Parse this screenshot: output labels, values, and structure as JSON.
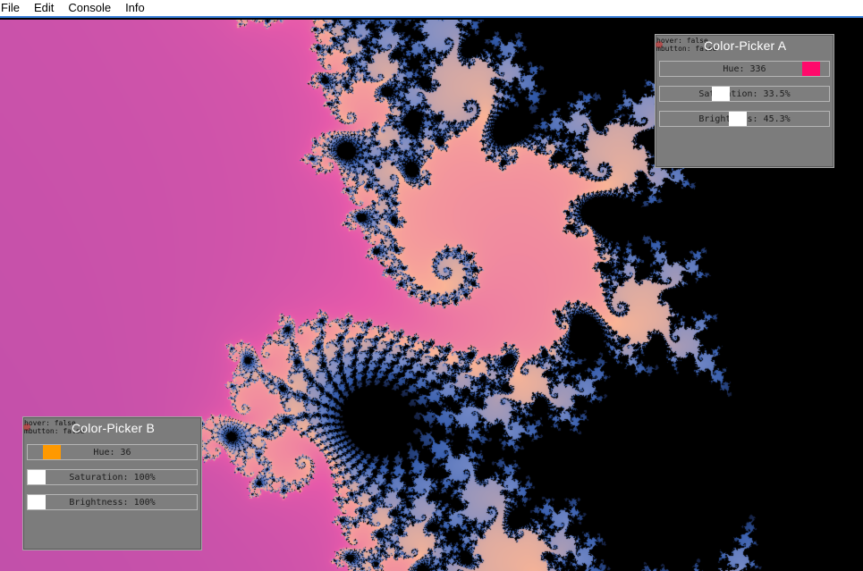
{
  "menu": {
    "items": [
      "File",
      "Edit",
      "Console",
      "Info"
    ]
  },
  "picker_a": {
    "title": "Color-Picker A",
    "debug_hover": "hover: false",
    "debug_mbutton": "mbutton: false",
    "hue": {
      "label": "Hue: 336",
      "value": 336,
      "swatch_color": "#ff0a6b"
    },
    "saturation": {
      "label": "Saturation: 33.5%",
      "value": 0.335
    },
    "brightness": {
      "label": "Brightness: 45.3%",
      "value": 0.453
    }
  },
  "picker_b": {
    "title": "Color-Picker B",
    "debug_hover": "hover: false",
    "debug_mbutton": "mbutton: false",
    "hue": {
      "label": "Hue: 36",
      "value": 36,
      "swatch_color": "#ff9900"
    },
    "saturation": {
      "label": "Saturation: 100%",
      "value": 1.0
    },
    "brightness": {
      "label": "Brightness: 100%",
      "value": 1.0
    }
  },
  "colors": {
    "accent": "#3b7fd9",
    "panel": "#7c7c7c",
    "knob_white": "#ffffff"
  }
}
